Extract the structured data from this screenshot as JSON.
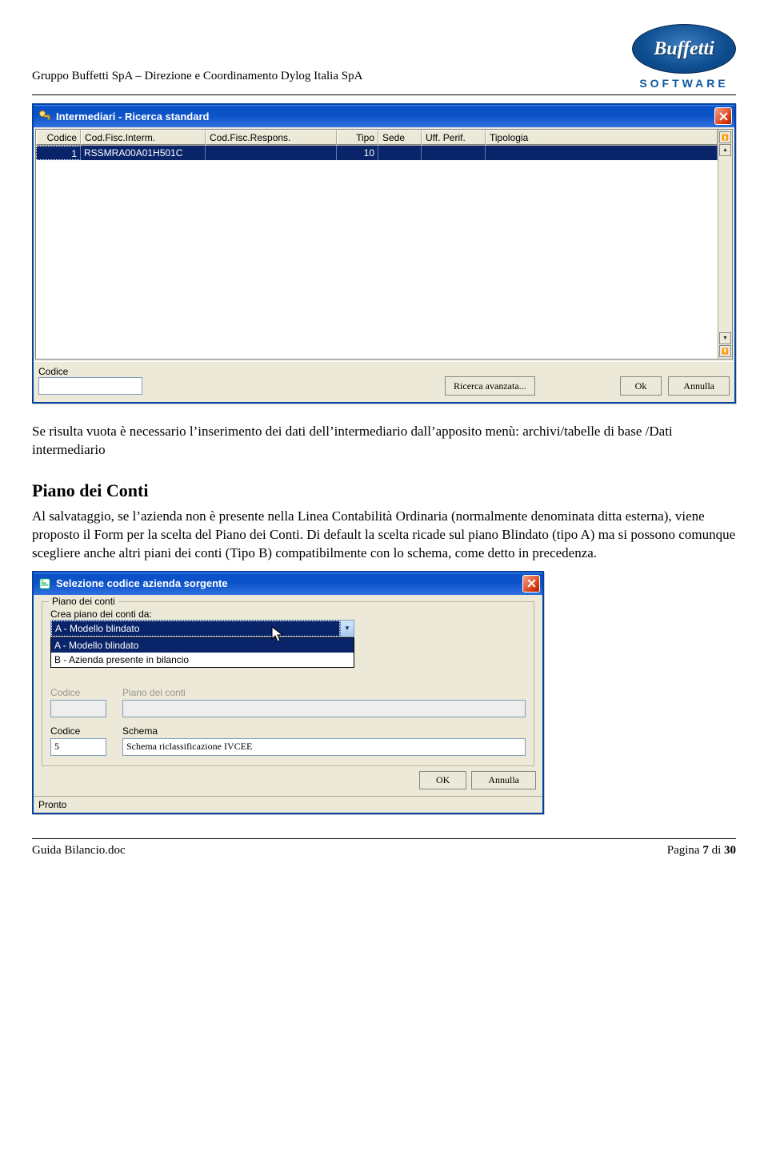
{
  "header": {
    "company": "Gruppo Buffetti SpA – Direzione e Coordinamento Dylog Italia SpA",
    "logo_text": "Buffetti",
    "logo_sub": "SOFTWARE"
  },
  "window1": {
    "title": "Intermediari - Ricerca standard",
    "columns": {
      "codice": "Codice",
      "cf_interm": "Cod.Fisc.Interm.",
      "cf_respons": "Cod.Fisc.Respons.",
      "tipo": "Tipo",
      "sede": "Sede",
      "uff": "Uff. Perif.",
      "tipologia": "Tipologia"
    },
    "row": {
      "codice": "1",
      "cf_interm": "RSSMRA00A01H501C",
      "cf_respons": "",
      "tipo": "10",
      "sede": "",
      "uff": "",
      "tipologia": ""
    },
    "bottom": {
      "codice_label": "Codice",
      "ricerca": "Ricerca avanzata...",
      "ok": "Ok",
      "annulla": "Annulla"
    }
  },
  "body": {
    "p1": "Se risulta vuota è necessario l’inserimento dei dati dell’intermediario dall’apposito menù: archivi/tabelle di base /Dati intermediario",
    "h2": "Piano dei Conti",
    "p2": "Al salvataggio, se l’azienda non è presente nella Linea Contabilità Ordinaria (normalmente denominata ditta esterna), viene proposto il Form per la scelta del Piano dei Conti. Di default la scelta ricade sul piano Blindato (tipo A) ma si possono comunque scegliere anche altri piani dei conti (Tipo B) compatibilmente con lo schema, come detto in precedenza."
  },
  "window2": {
    "title": "Selezione codice azienda sorgente",
    "group_title": "Piano dei conti",
    "crea_label": "Crea piano dei conti da:",
    "combo_selected": "A - Modello blindato",
    "options": {
      "a": "A - Modello blindato",
      "b": "B - Azienda presente in bilancio"
    },
    "codice_label": "Codice",
    "piano_label": "Piano dei conti",
    "codice2_label": "Codice",
    "schema_label": "Schema",
    "codice2_value": "5",
    "schema_value": "Schema riclassificazione IVCEE",
    "ok": "OK",
    "annulla": "Annulla",
    "status": "Pronto"
  },
  "footer": {
    "doc": "Guida Bilancio.doc",
    "page_prefix": "Pagina ",
    "page_num": "7",
    "page_sep": " di ",
    "page_total": "30"
  }
}
